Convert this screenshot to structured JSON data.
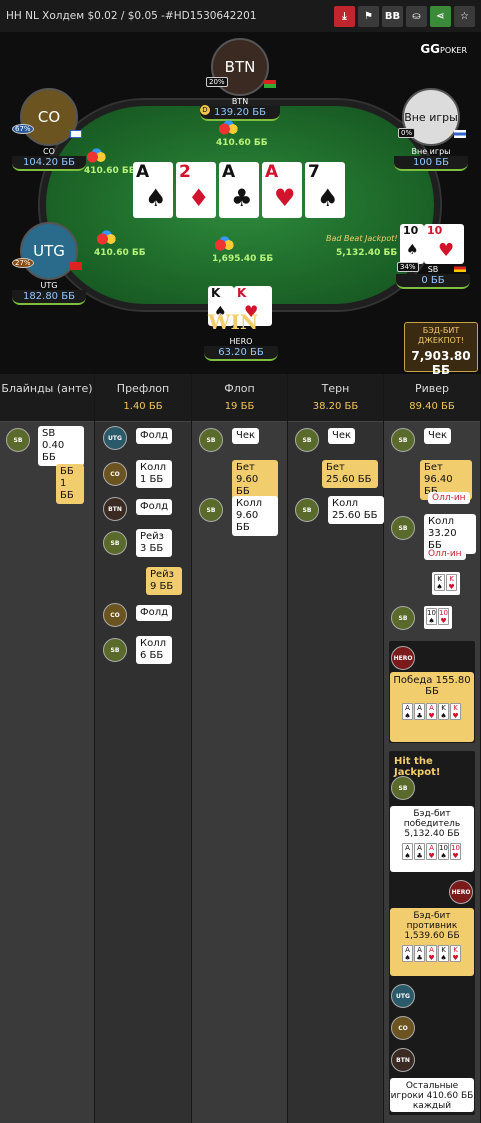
{
  "header": {
    "title": "HH NL Холдем $0.02 / $0.05 -#HD1530642201"
  },
  "toolbar": {
    "download": "download-icon",
    "report": "flag-icon",
    "bb_label": "BB",
    "replay": "replay-icon",
    "share": "share-icon",
    "star": "star-icon"
  },
  "logo": {
    "main": "GG",
    "sub": "POKER"
  },
  "seats": {
    "btn": {
      "avatar": "BTN",
      "name": "BTN",
      "stack": "139.20 ББ",
      "pct": "20%"
    },
    "co": {
      "avatar": "CO",
      "name": "CO",
      "stack": "104.20 ББ",
      "pct": "67%"
    },
    "out": {
      "avatar": "Вне игры",
      "name": "Вне игры",
      "stack": "100 ББ",
      "pct": "0%"
    },
    "utg": {
      "avatar": "UTG",
      "name": "UTG",
      "stack": "182.80 ББ",
      "pct": "27%"
    },
    "sb": {
      "name": "SB",
      "stack": "0 ББ",
      "pct": "34%",
      "bad_beat": "Bad Beat Jackpot!"
    },
    "hero": {
      "name": "HERO",
      "stack": "63.20 ББ",
      "win": "WIN"
    }
  },
  "pots": {
    "btn": "410.60 ББ",
    "co": "410.60 ББ",
    "utg": "410.60 ББ",
    "main": "1,695.40 ББ",
    "sb": "5,132.40 ББ"
  },
  "board": [
    {
      "rank": "A",
      "suit": "♠",
      "red": false
    },
    {
      "rank": "2",
      "suit": "♦",
      "red": true
    },
    {
      "rank": "A",
      "suit": "♣",
      "red": false
    },
    {
      "rank": "A",
      "suit": "♥",
      "red": true
    },
    {
      "rank": "7",
      "suit": "♠",
      "red": false
    }
  ],
  "jackpot": {
    "label": "БЭД-БИТ ДЖЕКПОТ!",
    "value": "7,903.80 ББ"
  },
  "history": {
    "cols": [
      {
        "name": "Блайнды (анте)",
        "value": ""
      },
      {
        "name": "Префлоп",
        "value": "1.40 ББ"
      },
      {
        "name": "Флоп",
        "value": "19 ББ"
      },
      {
        "name": "Терн",
        "value": "38.20 ББ"
      },
      {
        "name": "Ривер",
        "value": "89.40 ББ"
      }
    ],
    "blinds": {
      "sb": "SB 0.40 ББ",
      "bb": "ББ 1 ББ"
    },
    "preflop": {
      "utg": "Фолд",
      "co": "Колл 1 ББ",
      "btn": "Фолд",
      "sb_raise": "Рейз 3 ББ",
      "hero_raise": "Рейз 9 ББ",
      "co2": "Фолд",
      "sb_call": "Колл 6 ББ"
    },
    "flop": {
      "sb": "Чек",
      "bet": "Бет 9.60 ББ",
      "call": "Колл 9.60 ББ"
    },
    "turn": {
      "sb": "Чек",
      "bet": "Бет 25.60 ББ",
      "call": "Колл 25.60 ББ"
    },
    "river": {
      "sb": "Чек",
      "bet": "Бет 96.40 ББ",
      "allin1": "Олл-ин",
      "call": "Колл 33.20 ББ",
      "allin2": "Олл-ин",
      "hero_tag": "HERO",
      "win": "Победа 155.80 ББ",
      "jackpot_title": "Hit the Jackpot!",
      "bb_winner": "Бэд-бит победитель 5,132.40 ББ",
      "bb_loser": "Бэд-бит противник 1,539.60 ББ",
      "others": "Остальные игроки 410.60 ББ каждый"
    }
  },
  "av": {
    "sb": "SB",
    "bb": "BB",
    "utg": "UTG",
    "co": "CO",
    "btn": "BTN",
    "hero": "HERO"
  }
}
